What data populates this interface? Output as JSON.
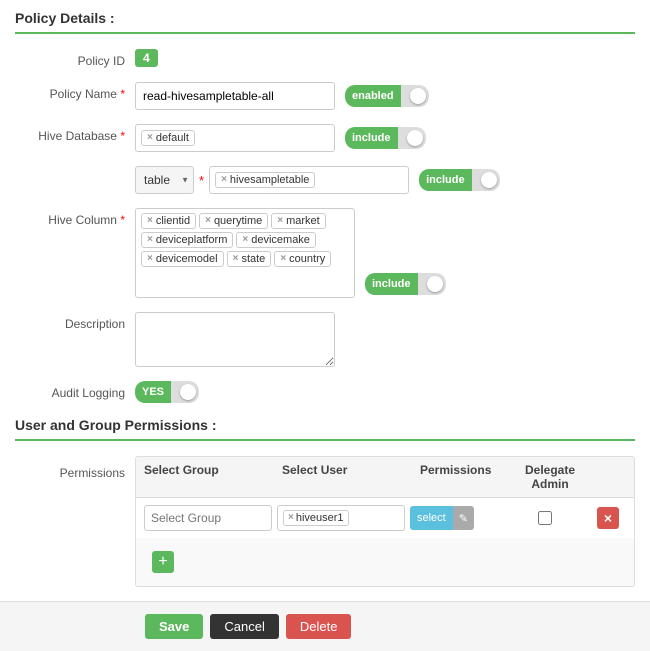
{
  "page": {
    "policy_details_title": "Policy Details :",
    "permissions_title": "User and Group Permissions :"
  },
  "policy_id": {
    "label": "Policy ID",
    "value": "4"
  },
  "policy_name": {
    "label": "Policy Name",
    "required": "*",
    "value": "read-hivesampletable-all",
    "toggle_label": "enabled"
  },
  "hive_database": {
    "label": "Hive Database",
    "required": "*",
    "tag": "default",
    "toggle_label": "include"
  },
  "hive_table": {
    "label": "",
    "required": "*",
    "dropdown_value": "table",
    "tag": "hivesampletable",
    "toggle_label": "include"
  },
  "hive_column": {
    "label": "Hive Column",
    "required": "*",
    "tags": [
      "clientid",
      "querytime",
      "market",
      "deviceplatform",
      "devicemake",
      "devicemodel",
      "state",
      "country"
    ],
    "toggle_label": "include"
  },
  "description": {
    "label": "Description",
    "value": ""
  },
  "audit_logging": {
    "label": "Audit Logging",
    "toggle_label": "YES"
  },
  "permissions": {
    "label": "Permissions",
    "table_headers": {
      "group": "Select Group",
      "user": "Select User",
      "permissions": "Permissions",
      "delegate": "Delegate Admin"
    },
    "row": {
      "group_placeholder": "Select Group",
      "user_tag": "hiveuser1",
      "select_btn": "select",
      "edit_icon": "✎"
    }
  },
  "buttons": {
    "save": "Save",
    "cancel": "Cancel",
    "delete": "Delete",
    "add_row": "+",
    "delete_row": "×"
  }
}
